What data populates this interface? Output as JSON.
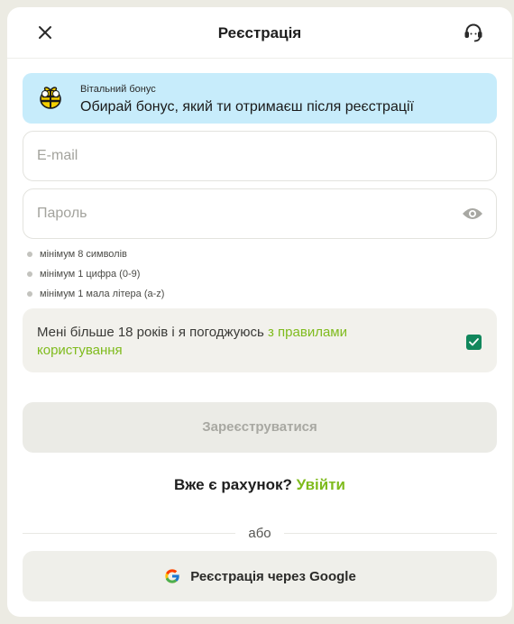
{
  "header": {
    "title": "Реєстрація",
    "close_icon": "close-icon",
    "support_icon": "headset-icon"
  },
  "bonus": {
    "icon": "bee-gift-icon",
    "small_label": "Вітальний бонус",
    "main_label": "Обирай бонус, який ти отримаєш після реєстрації",
    "background": "#c7ecfb"
  },
  "email": {
    "placeholder": "E-mail",
    "value": ""
  },
  "password": {
    "placeholder": "Пароль",
    "value": "",
    "toggle_icon": "eye-icon"
  },
  "password_rules": [
    "мінімум 8 символів",
    "мінімум 1 цифра (0-9)",
    "мінімум 1 мала літера (a-z)"
  ],
  "agreement": {
    "text": "Мені більше 18 років і я погоджуюсь ",
    "link": "з правилами користування",
    "checked": true,
    "checkbox_color": "#11875c"
  },
  "submit": {
    "label": "Зареєструватися"
  },
  "login": {
    "question": "Вже є рахунок?",
    "link": "Увійти"
  },
  "divider": {
    "text": "або"
  },
  "google": {
    "label": "Реєстрація через Google",
    "icon": "google-icon"
  },
  "colors": {
    "accent_green": "#7fbb1d",
    "brand_yellow": "#f5d000"
  }
}
